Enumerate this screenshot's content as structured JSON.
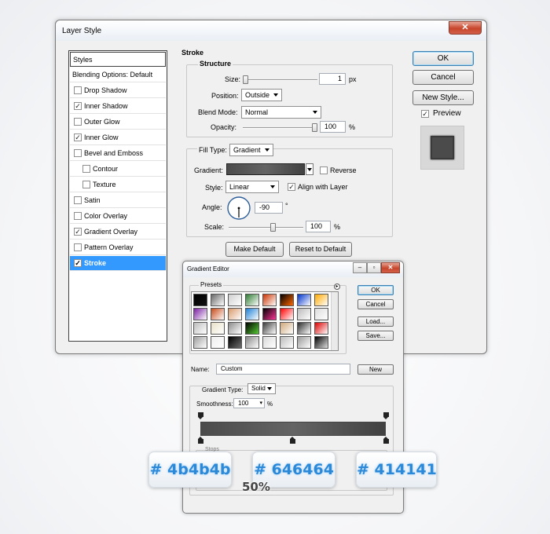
{
  "layer_style": {
    "title": "Layer Style",
    "close_glyph": "✕",
    "styles_list": [
      {
        "label": "Styles",
        "checked": null,
        "header": true
      },
      {
        "label": "Blending Options: Default",
        "checked": null,
        "header": true
      },
      {
        "label": "Drop Shadow",
        "checked": false
      },
      {
        "label": "Inner Shadow",
        "checked": true
      },
      {
        "label": "Outer Glow",
        "checked": false
      },
      {
        "label": "Inner Glow",
        "checked": true
      },
      {
        "label": "Bevel and Emboss",
        "checked": false
      },
      {
        "label": "Contour",
        "checked": false,
        "indent": true
      },
      {
        "label": "Texture",
        "checked": false,
        "indent": true
      },
      {
        "label": "Satin",
        "checked": false
      },
      {
        "label": "Color Overlay",
        "checked": false
      },
      {
        "label": "Gradient Overlay",
        "checked": true
      },
      {
        "label": "Pattern Overlay",
        "checked": false
      },
      {
        "label": "Stroke",
        "checked": true,
        "selected": true
      }
    ],
    "stroke": {
      "section_title": "Stroke",
      "structure_title": "Structure",
      "size_label": "Size:",
      "size_value": "1",
      "size_unit": "px",
      "position_label": "Position:",
      "position_value": "Outside",
      "blend_mode_label": "Blend Mode:",
      "blend_mode_value": "Normal",
      "opacity_label": "Opacity:",
      "opacity_value": "100",
      "opacity_unit": "%",
      "fill_type_label": "Fill Type:",
      "fill_type_value": "Gradient",
      "gradient_label": "Gradient:",
      "reverse_label": "Reverse",
      "reverse_checked": false,
      "style_label": "Style:",
      "style_value": "Linear",
      "align_label": "Align with Layer",
      "align_checked": true,
      "angle_label": "Angle:",
      "angle_value": "-90",
      "angle_unit": "°",
      "scale_label": "Scale:",
      "scale_value": "100",
      "scale_unit": "%",
      "size_slider_fraction": 0.0,
      "opacity_slider_fraction": 1.0,
      "scale_slider_fraction": 0.6
    },
    "buttons": {
      "ok": "OK",
      "cancel": "Cancel",
      "new_style": "New Style...",
      "preview": "Preview",
      "preview_checked": true,
      "make_default": "Make Default",
      "reset_to_default": "Reset to Default"
    }
  },
  "gradient_editor": {
    "title": "Gradient Editor",
    "presets_label": "Presets",
    "ok": "OK",
    "cancel": "Cancel",
    "load": "Load...",
    "save": "Save...",
    "name_label": "Name:",
    "name_value": "Custom",
    "new_button": "New",
    "gradient_type_label": "Gradient Type:",
    "gradient_type_value": "Solid",
    "smoothness_label": "Smoothness:",
    "smoothness_value": "100",
    "smoothness_unit": "%",
    "stops_label": "Stops",
    "preset_colors": [
      [
        "#111111",
        "#666666",
        "#cfcfcf",
        "#2e7d32",
        "#cc3300",
        "#ff6600",
        "#0033cc",
        "#ffaa00"
      ],
      [
        "#7a1fa2",
        "#c84b1a",
        "#d99a6c",
        "#1b7fd6",
        "#ff3399",
        "#ff0000",
        "#bbbbbb",
        "#dddddd"
      ],
      [
        "#bdbdbd",
        "#e8e0c8",
        "#8c8c8c",
        "#55cc33",
        "#3c3c3c",
        "#cfa77a",
        "#2c2c2c",
        "#dd0000"
      ],
      [
        "#9e9e9e",
        "#eeeeee",
        "#6f6f6f",
        "#888888",
        "#dadada",
        "#bbbbbb",
        "#999999",
        "#e0e0e0"
      ]
    ]
  },
  "callouts": {
    "left_hex": "# 4b4b4b",
    "mid_hex": "# 646464",
    "right_hex": "# 414141",
    "mid_location": "50%"
  },
  "gradient_colors": [
    "#4b4b4b",
    "#646464",
    "#414141"
  ]
}
